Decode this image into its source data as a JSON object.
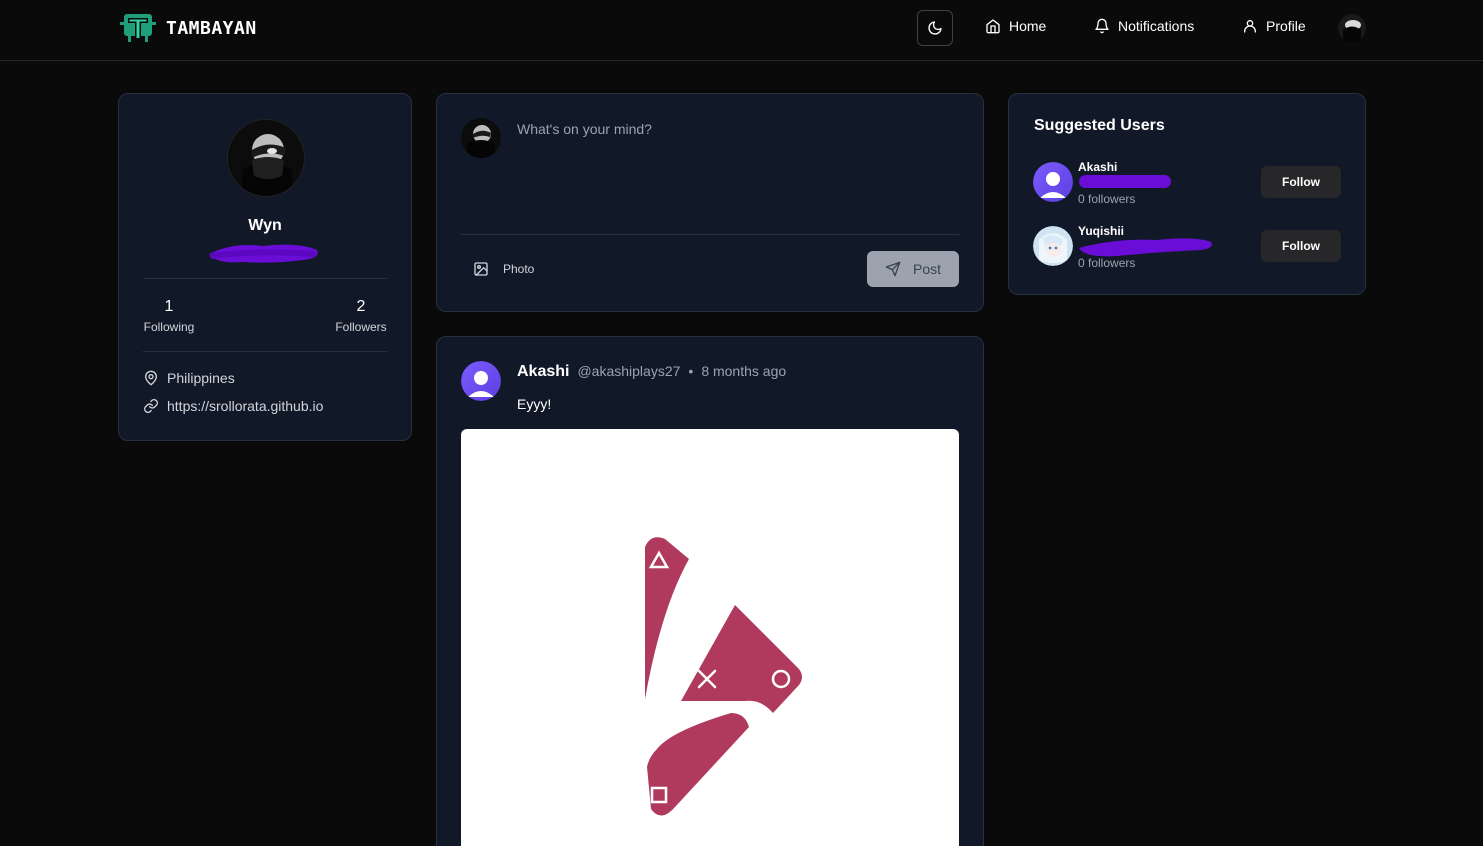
{
  "app": {
    "name": "TAMBAYAN"
  },
  "nav": {
    "theme_icon": "moon-icon",
    "home_label": "Home",
    "notifications_label": "Notifications",
    "profile_label": "Profile"
  },
  "profile": {
    "name": "Wyn",
    "following_count": "1",
    "following_label": "Following",
    "followers_count": "2",
    "followers_label": "Followers",
    "location": "Philippines",
    "website": "https://srollorata.github.io"
  },
  "composer": {
    "placeholder": "What's on your mind?",
    "photo_label": "Photo",
    "post_label": "Post"
  },
  "post": {
    "author": "Akashi",
    "handle": "@akashiplays27",
    "separator": "•",
    "time": "8 months ago",
    "text": "Eyyy!"
  },
  "suggested": {
    "title": "Suggested Users",
    "users": [
      {
        "name": "Akashi",
        "followers": "0 followers",
        "follow_label": "Follow"
      },
      {
        "name": "Yuqishii",
        "followers": "0 followers",
        "follow_label": "Follow"
      }
    ]
  },
  "colors": {
    "background": "#0a0a0a",
    "card": "#111827",
    "accent_logo": "#2dd4a0",
    "redaction": "#6a0dd6",
    "post_image_mark": "#b03a5e"
  }
}
